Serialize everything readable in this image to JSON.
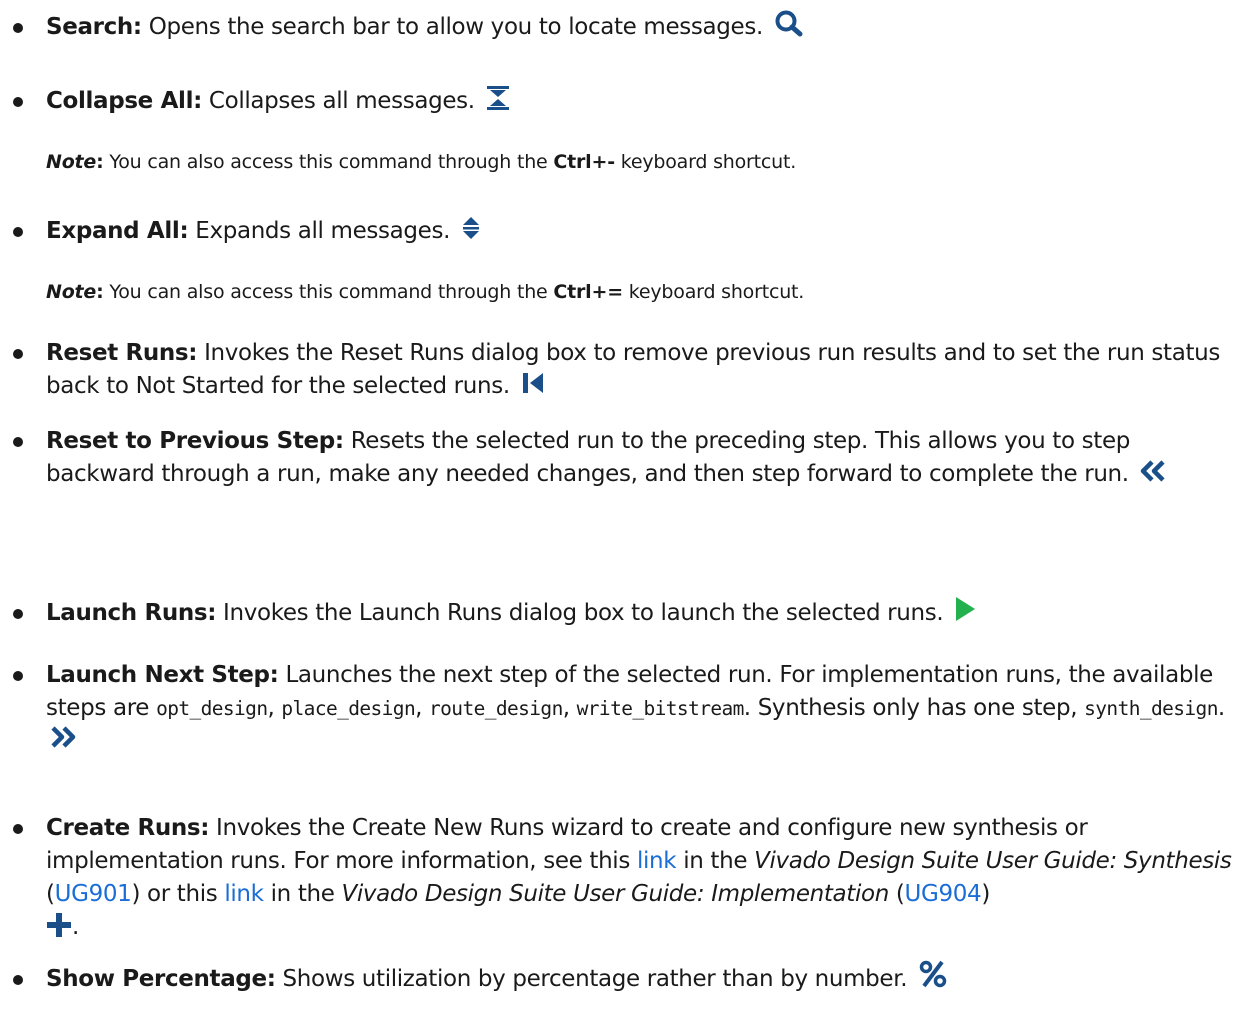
{
  "items": {
    "search": {
      "term": "Search:",
      "text": " Opens the search bar to allow you to locate messages.",
      "icon": "magnifier-icon"
    },
    "collapse_all": {
      "term": "Collapse All:",
      "text": " Collapses all messages.",
      "icon": "collapse-all-icon",
      "note": {
        "label": "Note",
        "colon": ":",
        "text_before": " You can also access this command through the ",
        "shortcut": "Ctrl+-",
        "text_after": " keyboard shortcut."
      }
    },
    "expand_all": {
      "term": "Expand All:",
      "text": " Expands all messages.",
      "icon": "expand-all-icon",
      "note": {
        "label": "Note",
        "colon": ":",
        "text_before": " You can also access this command through the ",
        "shortcut": "Ctrl+=",
        "text_after": " keyboard shortcut."
      }
    },
    "reset_runs": {
      "term": "Reset Runs:",
      "text": " Invokes the Reset Runs dialog box to remove previous run results and to set the run status back to Not Started for the selected runs.",
      "icon": "reset-runs-icon"
    },
    "reset_prev": {
      "term": "Reset to Previous Step:",
      "text": " Resets the selected run to the preceding step. This allows you to step backward through a run, make any needed changes, and then step forward to complete the run.",
      "icon": "double-chevron-left-icon"
    },
    "launch_runs": {
      "term": "Launch Runs:",
      "text": " Invokes the Launch Runs dialog box to launch the selected runs.",
      "icon": "play-icon"
    },
    "launch_next": {
      "term": "Launch Next Step:",
      "text_1": " Launches the next step of the selected run. For implementation runs, the available steps are ",
      "code_1": "opt_design",
      "sep_1": ", ",
      "code_2": "place_design",
      "sep_2": ", ",
      "code_3": "route_design",
      "sep_3": ", ",
      "code_4": "write_bitstream",
      "text_2": ". Synthesis only has one step, ",
      "code_5": "synth_design",
      "text_3": ".",
      "icon": "double-chevron-right-icon"
    },
    "create_runs": {
      "term": "Create Runs:",
      "text_1": " Invokes the Create New Runs wizard to create and configure new synthesis or implementation runs. For more information, see this ",
      "link_1": "link",
      "text_2": " in the ",
      "title_1": "Vivado Design Suite User Guide: Synthesis",
      "text_3": " (",
      "doc_1": "UG901",
      "text_4": ") or this ",
      "link_2": "link",
      "text_5": " in the ",
      "title_2": "Vivado Design Suite User Guide: Implementation",
      "text_6": " (",
      "doc_2": "UG904",
      "text_7": ")",
      "text_8": ".",
      "icon": "plus-icon"
    },
    "show_percentage": {
      "term": "Show Percentage:",
      "text": " Shows utilization by percentage rather than by number.",
      "icon": "percent-icon"
    }
  },
  "colors": {
    "text": "#1a1a1a",
    "link": "#1a6dd6",
    "icon_blue": "#1a4f8a",
    "icon_green": "#22b14c"
  }
}
